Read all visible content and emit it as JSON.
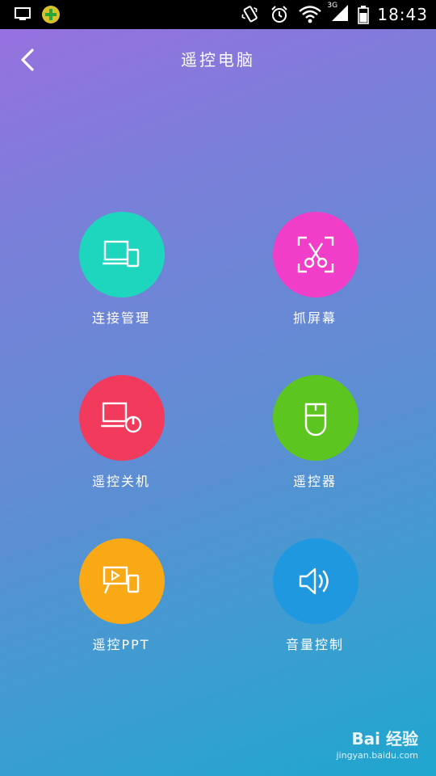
{
  "status_bar": {
    "network_label": "3G",
    "time": "18:43",
    "icons": [
      "monitor-icon",
      "app-icon",
      "vibrate-icon",
      "alarm-icon",
      "wifi-icon",
      "signal-icon",
      "battery-icon"
    ]
  },
  "header": {
    "title": "遥控电脑",
    "back_icon": "chevron-left-icon"
  },
  "features": [
    {
      "label": "连接管理",
      "icon": "devices-icon",
      "color": "#1ed6be"
    },
    {
      "label": "抓屏幕",
      "icon": "scissors-icon",
      "color": "#f03ec8"
    },
    {
      "label": "遥控关机",
      "icon": "monitor-power-icon",
      "color": "#f23a5d"
    },
    {
      "label": "遥控器",
      "icon": "mouse-icon",
      "color": "#5cc51f"
    },
    {
      "label": "遥控PPT",
      "icon": "presentation-icon",
      "color": "#f9a816"
    },
    {
      "label": "音量控制",
      "icon": "speaker-icon",
      "color": "#1f98e0"
    }
  ],
  "watermark": {
    "main": "Bai 经验",
    "sub": "jingyan.baidu.com"
  }
}
